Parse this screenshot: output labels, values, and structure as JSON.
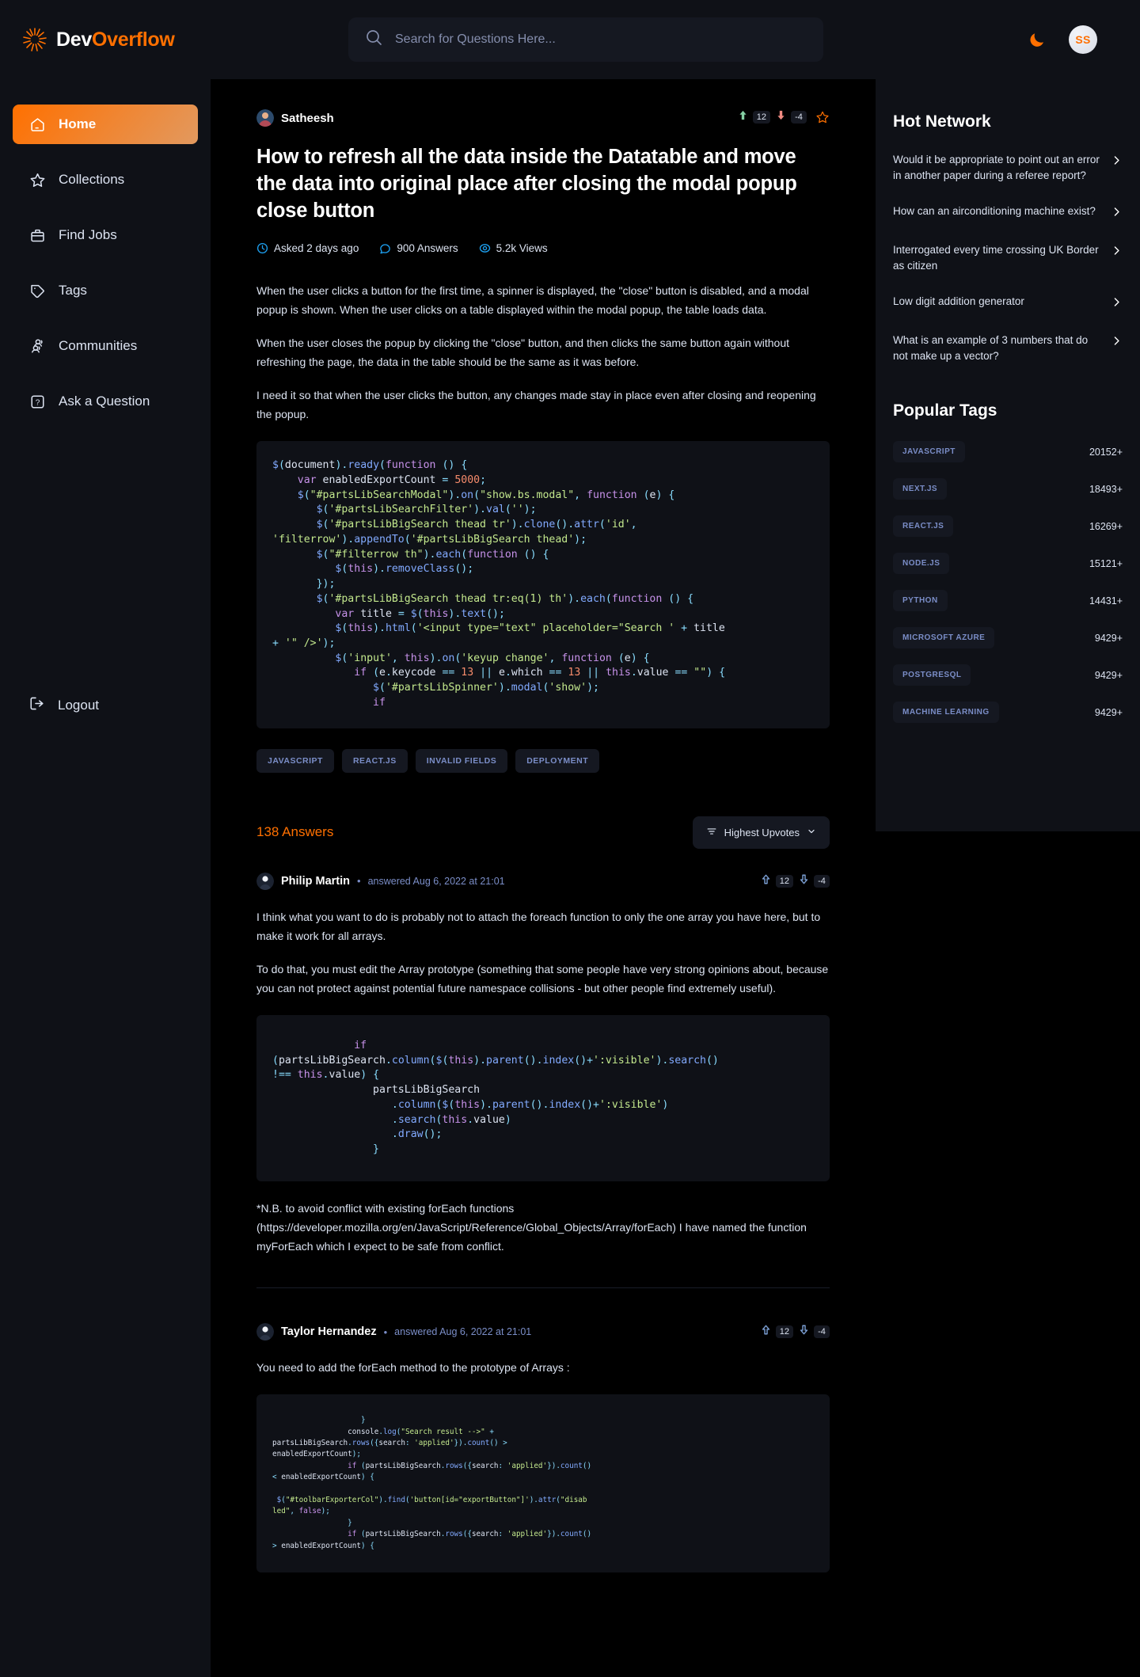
{
  "brand": {
    "part1": "Dev",
    "part2": "Overflow",
    "logo_icon": "sun-burst-logo-icon"
  },
  "search": {
    "placeholder": "Search for Questions Here...",
    "value": "",
    "icon": "search-icon"
  },
  "navbar": {
    "theme_toggle_icon": "moon-icon",
    "avatar_initials": "SS"
  },
  "sidebar": {
    "items": [
      {
        "label": "Home",
        "icon": "home-icon",
        "active": true
      },
      {
        "label": "Collections",
        "icon": "star-icon",
        "active": false
      },
      {
        "label": "Find Jobs",
        "icon": "briefcase-icon",
        "active": false
      },
      {
        "label": "Tags",
        "icon": "tag-icon",
        "active": false
      },
      {
        "label": "Communities",
        "icon": "users-icon",
        "active": false
      },
      {
        "label": "Ask a Question",
        "icon": "question-mark-icon",
        "active": false
      }
    ],
    "logout": {
      "label": "Logout",
      "icon": "logout-icon"
    }
  },
  "question": {
    "author": "Satheesh",
    "upvotes": "12",
    "downvotes": "-4",
    "title": "How to refresh all the data inside the Datatable and move the data into original place after closing the modal popup close button",
    "meta": {
      "asked": "Asked 2 days ago",
      "answers": "900 Answers",
      "answers_number": "900",
      "answers_word": "Answers",
      "views": "5.2k Views",
      "views_number": "5.2k",
      "views_word": "Views"
    },
    "paragraphs": [
      "When the user clicks a button for the first time, a spinner is displayed, the \"close\" button is disabled, and a modal popup is shown. When the user clicks on a table displayed within the modal popup, the table loads data.",
      "When the user closes the popup by clicking the \"close\" button, and then clicks the same button again without refreshing the page, the data in the table should be the same as it was before.",
      "I need it so that when the user clicks the button, any changes made stay in place even after closing and reopening the popup."
    ],
    "tags": [
      "JAVASCRIPT",
      "REACT.JS",
      "INVALID FIELDS",
      "DEPLOYMENT"
    ]
  },
  "answers_section": {
    "count_label": "138 Answers",
    "filter_label": "Highest Upvotes",
    "filter_icon": "filter-icon",
    "chevron_icon": "chevron-down-icon"
  },
  "answers": [
    {
      "author": "Philip Martin",
      "separator": "•",
      "date": "answered Aug 6, 2022 at 21:01",
      "upvotes": "12",
      "downvotes": "-4",
      "paragraphs": [
        "I think what you want to do is probably not to attach the foreach function to only the one array you have here, but to make it work for all arrays.",
        "To do that, you must edit the Array prototype (something that some people have very strong opinions about, because you can not protect against potential future namespace collisions - but other people find extremely useful)."
      ],
      "footnote": "*N.B. to avoid conflict with existing forEach functions (https://developer.mozilla.org/en/JavaScript/Reference/Global_Objects/Array/forEach) I have named the function myForEach which I expect to be safe from conflict."
    },
    {
      "author": "Taylor Hernandez",
      "separator": "•",
      "date": "answered Aug 6, 2022 at 21:01",
      "upvotes": "12",
      "downvotes": "-4",
      "paragraphs": [
        "You need to add the forEach method to the prototype of Arrays :"
      ]
    }
  ],
  "hot_network": {
    "title": "Hot Network",
    "items": [
      "Would it be appropriate to point out an error in another paper during a referee report?",
      "How can an airconditioning machine exist?",
      "Interrogated every time crossing UK Border as citizen",
      "Low digit addition generator",
      "What is an example of 3 numbers that do not make up a vector?"
    ]
  },
  "popular_tags": {
    "title": "Popular Tags",
    "items": [
      {
        "name": "JAVASCRIPT",
        "count": "20152+"
      },
      {
        "name": "NEXT.JS",
        "count": "18493+"
      },
      {
        "name": "REACT.JS",
        "count": "16269+"
      },
      {
        "name": "NODE.JS",
        "count": "15121+"
      },
      {
        "name": "PYTHON",
        "count": "14431+"
      },
      {
        "name": "MICROSOFT AZURE",
        "count": "9429+"
      },
      {
        "name": "POSTGRESQL",
        "count": "9429+"
      },
      {
        "name": "MACHINE LEARNING",
        "count": "9429+"
      }
    ]
  },
  "colors": {
    "accent": "#ff7000",
    "dark_bg": "#000000",
    "panel_bg": "#0f1117",
    "chip_bg": "#151821",
    "text_primary": "#ffffff",
    "text_secondary": "#dce3f1",
    "text_muted": "#7b8ec8",
    "upvote_green": "#85cfa3",
    "downvote_red": "#f08b82",
    "meta_blue": "#1da1f2"
  },
  "code_blocks": {
    "question": "$(document).ready(function () {\n    var enabledExportCount = 5000;\n    $(\"#partsLibSearchModal\").on(\"show.bs.modal\", function (e) {\n       $('#partsLibSearchFilter').val('');\n       $('#partsLibBigSearch thead tr').clone().attr('id',\n'filterrow').appendTo('#partsLibBigSearch thead');\n       $(\"#filterrow th\").each(function () {\n          $(this).removeClass();\n       });\n       $('#partsLibBigSearch thead tr:eq(1) th').each(function () {\n          var title = $(this).text();\n          $(this).html('<input type=\"text\" placeholder=\"Search ' + title\n+ '\" />');\n          $('input', this).on('keyup change', function (e) {\n             if (e.keycode == 13 || e.which == 13 || this.value == \"\") {\n                $('#partsLibSpinner').modal('show');\n                if",
    "answer1": "             if\n(partsLibBigSearch.column($(this).parent().index()+':visible').search()\n!== this.value) {\n                partsLibBigSearch\n                   .column($(this).parent().index()+':visible')\n                   .search(this.value)\n                   .draw();\n                }",
    "answer2": "                    }\n                 console.log(\"Search result -->\" +\npartsLibBigSearch.rows({search: 'applied'}).count() >\nenabledExportCount);\n                 if (partsLibBigSearch.rows({search: 'applied'}).count()\n< enabledExportCount) {\n\n $(\"#toolbarExporterCol\").find('button[id=\"exportButton\"]').attr(\"disab\nled\", false);\n                 }\n                 if (partsLibBigSearch.rows({search: 'applied'}).count()\n> enabledExportCount) {"
  }
}
